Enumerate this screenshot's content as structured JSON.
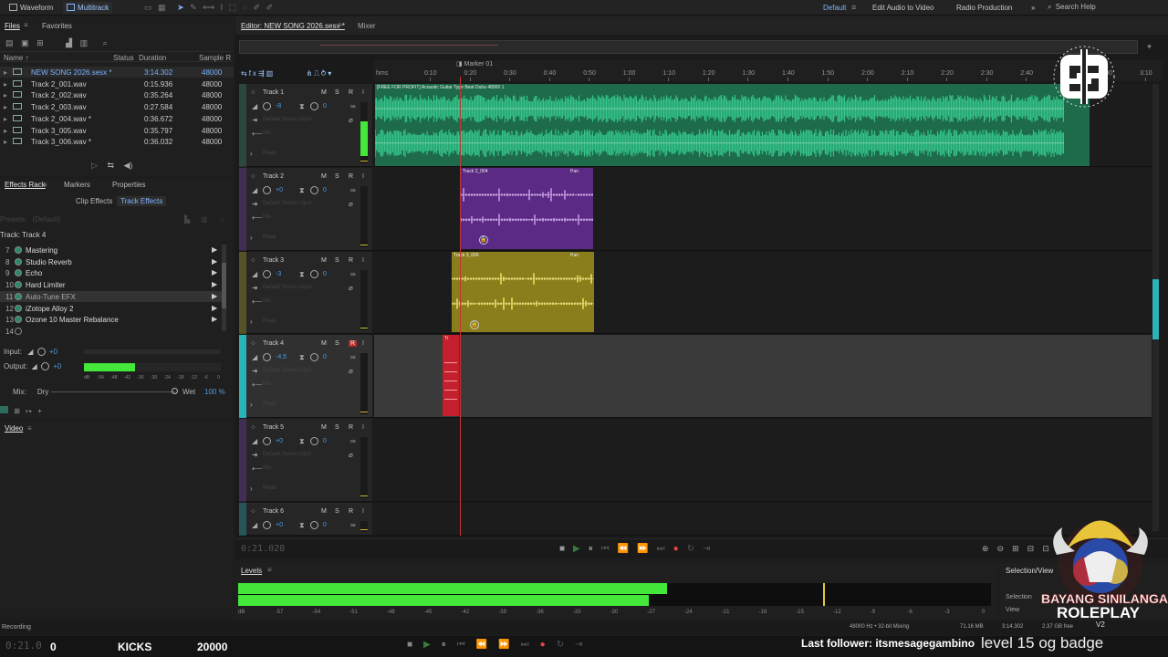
{
  "topbar": {
    "waveform": "Waveform",
    "multitrack": "Multitrack",
    "workspaces": [
      "Default",
      "Edit Audio to Video",
      "Radio Production"
    ],
    "more": "»",
    "search_placeholder": "Search Help"
  },
  "files_panel": {
    "tabs": [
      "Files",
      "Favorites"
    ],
    "columns": [
      "Name ↑",
      "Status",
      "Duration",
      "Sample R"
    ],
    "items": [
      {
        "name": "NEW SONG 2026.sesx *",
        "duration": "3:14.302",
        "rate": "48000",
        "selected": true
      },
      {
        "name": "Track 2_001.wav",
        "duration": "0:15.936",
        "rate": "48000"
      },
      {
        "name": "Track 2_002.wav",
        "duration": "0:35.264",
        "rate": "48000"
      },
      {
        "name": "Track 2_003.wav",
        "duration": "0:27.584",
        "rate": "48000"
      },
      {
        "name": "Track 2_004.wav *",
        "duration": "0:36.672",
        "rate": "48000"
      },
      {
        "name": "Track 3_005.wav",
        "duration": "0:35.797",
        "rate": "48000"
      },
      {
        "name": "Track 3_006.wav *",
        "duration": "0:36.032",
        "rate": "48000"
      }
    ]
  },
  "effects_panel": {
    "tabs": [
      "Effects Rack",
      "Markers",
      "Properties"
    ],
    "subtabs": [
      "Clip Effects",
      "Track Effects"
    ],
    "presets_label": "Presets:",
    "presets_value": "(Default)",
    "track_label": "Track: Track 4",
    "effects": [
      {
        "num": "7",
        "name": "Mastering"
      },
      {
        "num": "8",
        "name": "Studio Reverb"
      },
      {
        "num": "9",
        "name": "Echo"
      },
      {
        "num": "10",
        "name": "Hard Limiter"
      },
      {
        "num": "11",
        "name": "Auto-Tune EFX"
      },
      {
        "num": "12",
        "name": "iZotope Alloy 2"
      },
      {
        "num": "13",
        "name": "Ozone 10 Master Rebalance"
      },
      {
        "num": "14",
        "name": ""
      }
    ],
    "input_label": "Input:",
    "input_val": "+0",
    "output_label": "Output:",
    "output_val": "+0",
    "meter_scale": [
      "dB",
      "-54",
      "-48",
      "-42",
      "-36",
      "-30",
      "-24",
      "-18",
      "-12",
      "-6",
      "0"
    ],
    "output_level": 0.37,
    "mix_label": "Mix:",
    "dry_label": "Dry",
    "wet_label": "Wet",
    "wet_val": "100 %"
  },
  "video_panel": {
    "title": "Video"
  },
  "editor": {
    "tabs": [
      "Editor: NEW SONG 2026.sesx *",
      "Mixer"
    ],
    "marker_label": "Marker 01",
    "time_labels": [
      "hms",
      "0:10",
      "0:20",
      "0:30",
      "0:40",
      "0:50",
      "1:00",
      "1:10",
      "1:20",
      "1:30",
      "1:40",
      "1:50",
      "2:00",
      "2:10",
      "2:20",
      "2:30",
      "2:40",
      "2:50",
      "3:00",
      "3:10"
    ],
    "tracks": [
      {
        "name": "Track 1",
        "vol": "-8",
        "pan": "0",
        "input": "Default Stereo Input",
        "mix": "Mix",
        "read": "Read"
      },
      {
        "name": "Track 2",
        "vol": "+0",
        "pan": "0",
        "input": "Default Stereo Input",
        "mix": "Mix",
        "read": "Read"
      },
      {
        "name": "Track 3",
        "vol": "-3",
        "pan": "0",
        "input": "Default Stereo Input",
        "mix": "Mix",
        "read": "Read"
      },
      {
        "name": "Track 4",
        "vol": "-4.5",
        "pan": "0",
        "input": "Default Stereo Input",
        "mix": "Mix",
        "read": "Read"
      },
      {
        "name": "Track 5",
        "vol": "+0",
        "pan": "0",
        "input": "Default Stereo Input",
        "mix": "Mix",
        "read": "Read"
      },
      {
        "name": "Track 6",
        "vol": "+0",
        "pan": "0"
      }
    ],
    "clips": {
      "track1": "[FREE FOR PROFIT] Acoustic Guitar Type Beat Duha 48000 1",
      "track2": "Track 2_004",
      "track3": "Track 3_006",
      "track4": "Tr",
      "pan": "Pan"
    },
    "current_time": "0:21.028",
    "msr": [
      "M",
      "S",
      "R"
    ],
    "input_btn": "I"
  },
  "levels": {
    "title": "Levels",
    "scale": [
      "dB",
      "-57",
      "-54",
      "-51",
      "-48",
      "-45",
      "-42",
      "-39",
      "-36",
      "-33",
      "-30",
      "-27",
      "-24",
      "-21",
      "-18",
      "-15",
      "-12",
      "-9",
      "-6",
      "-3",
      "0"
    ],
    "left_level": 0.825,
    "right_level": 0.79
  },
  "selection_view": {
    "title": "Selection/View",
    "rows": [
      "Selection",
      "View"
    ]
  },
  "status": {
    "left": "Recording",
    "format": "48000 Hz • 32-bit Mixing",
    "size": "71.16 MB",
    "duration": "3:14.302",
    "free": "2.37 GB free"
  },
  "overlay": {
    "time": "0:21.0",
    "counter": "0",
    "kicks": "KICKS",
    "value": "20000",
    "follower": "Last follower: itsmesagegambino",
    "ticker": "level 15 og badge",
    "badge_line1": "BAYANG SINILANGAN",
    "badge_line2": "ROLEPLAY",
    "badge_line3": "V2",
    "tm": "TRIBE"
  },
  "colors": {
    "track1": "#2eb37d",
    "track2": "#7c3fa8",
    "track3": "#c7b92a",
    "track4": "#d42431",
    "accent": "#4a9be8",
    "meter": "#44e83a"
  }
}
